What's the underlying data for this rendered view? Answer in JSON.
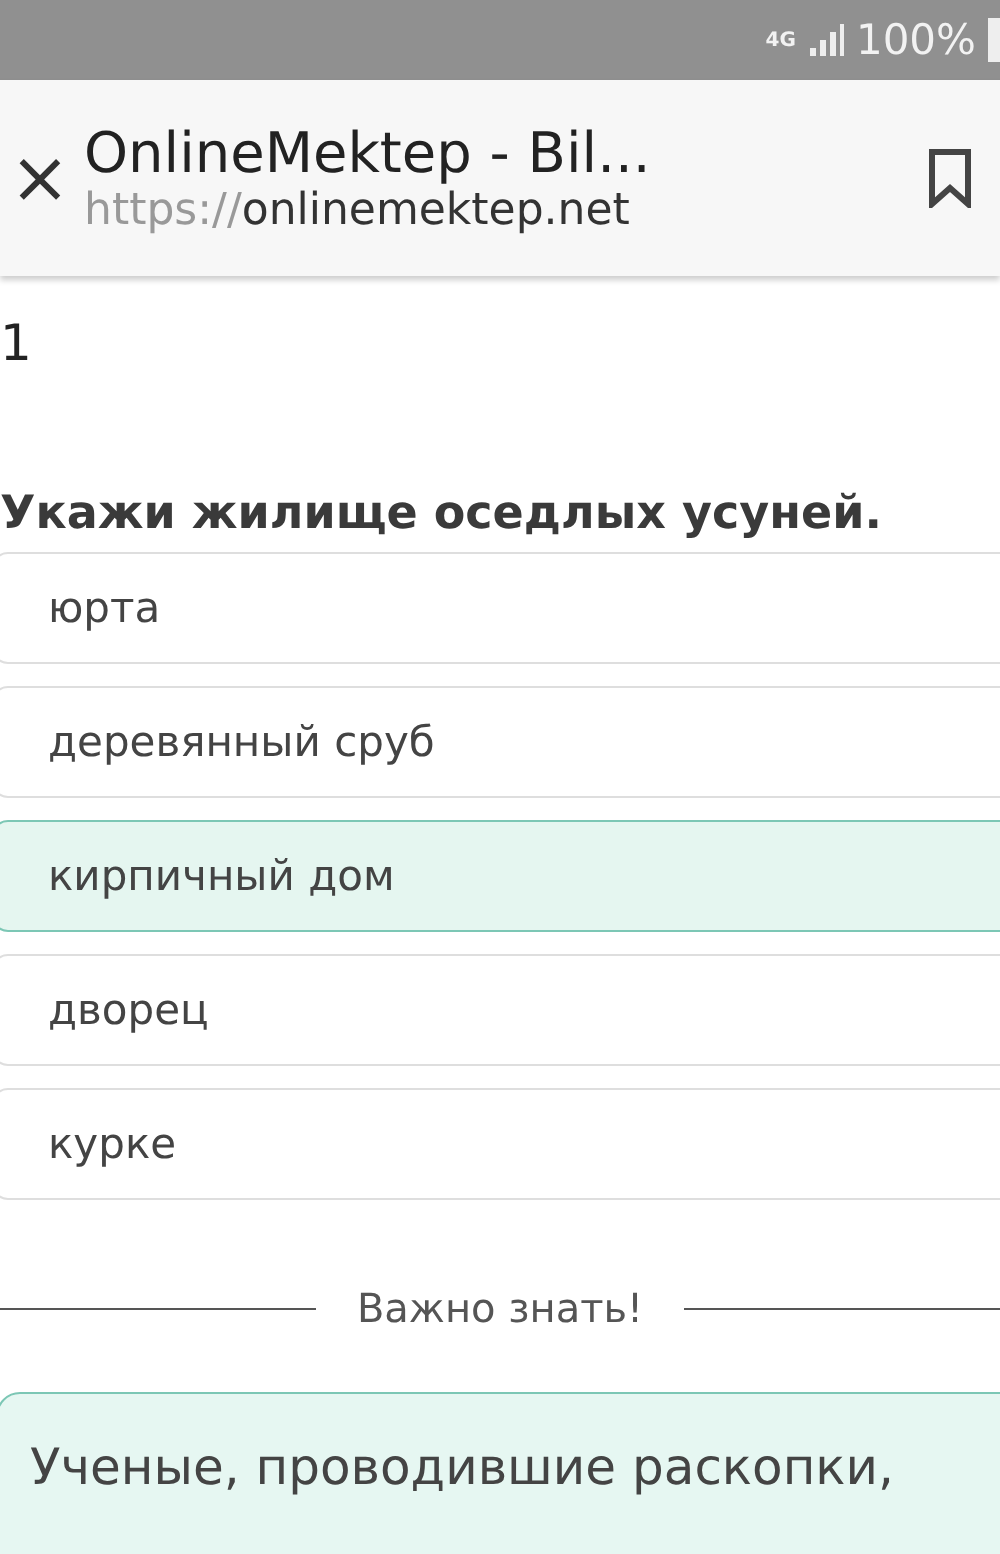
{
  "status_bar": {
    "network": "4G",
    "battery": "100%"
  },
  "browser": {
    "close": "×",
    "title": "OnlineMektep - Bil...",
    "url_scheme": "https://",
    "url_host": "onlinemektep.net"
  },
  "lesson_title": {
    "line_2": "1"
  },
  "question": "Укажи жилище оседлых усуней.",
  "options": [
    {
      "label": "юрта",
      "selected": false
    },
    {
      "label": "деревянный сруб",
      "selected": false
    },
    {
      "label": "кирпичный дом",
      "selected": true
    },
    {
      "label": "дворец",
      "selected": false
    },
    {
      "label": "курке",
      "selected": false
    }
  ],
  "divider_label": "Важно знать!",
  "info_text": "Ученые, проводившие раскопки,"
}
